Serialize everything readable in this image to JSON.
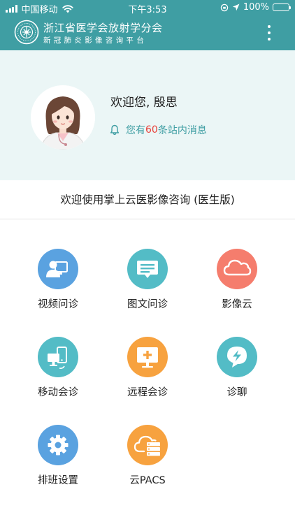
{
  "status_bar": {
    "carrier": "中国移动",
    "time": "下午3:53",
    "battery": "100%",
    "battery_level": 1.0
  },
  "header": {
    "title": "浙江省医学会放射学分会",
    "subtitle": "新冠肺炎影像咨询平台",
    "menu_icon": "more-vertical-icon"
  },
  "profile": {
    "greeting": "欢迎您, 殷思",
    "messages_prefix": "您有",
    "message_count": "60",
    "messages_suffix": "条站内消息"
  },
  "banner": {
    "text": "欢迎使用掌上云医影像咨询 (医生版)"
  },
  "grid": [
    {
      "label": "视频问诊",
      "icon": "video-consult-icon",
      "color": "#5aa2e0"
    },
    {
      "label": "图文问诊",
      "icon": "chat-message-icon",
      "color": "#53bcc6"
    },
    {
      "label": "影像云",
      "icon": "cloud-icon",
      "color": "#f57d6d"
    },
    {
      "label": "移动会诊",
      "icon": "mobile-devices-icon",
      "color": "#53bcc6"
    },
    {
      "label": "远程会诊",
      "icon": "remote-monitor-plus-icon",
      "color": "#f7a23f"
    },
    {
      "label": "诊聊",
      "icon": "lightning-chat-icon",
      "color": "#53bcc6"
    },
    {
      "label": "排班设置",
      "icon": "gear-icon",
      "color": "#5aa2e0"
    },
    {
      "label": "云PACS",
      "icon": "cloud-server-icon",
      "color": "#f7a23f"
    }
  ]
}
